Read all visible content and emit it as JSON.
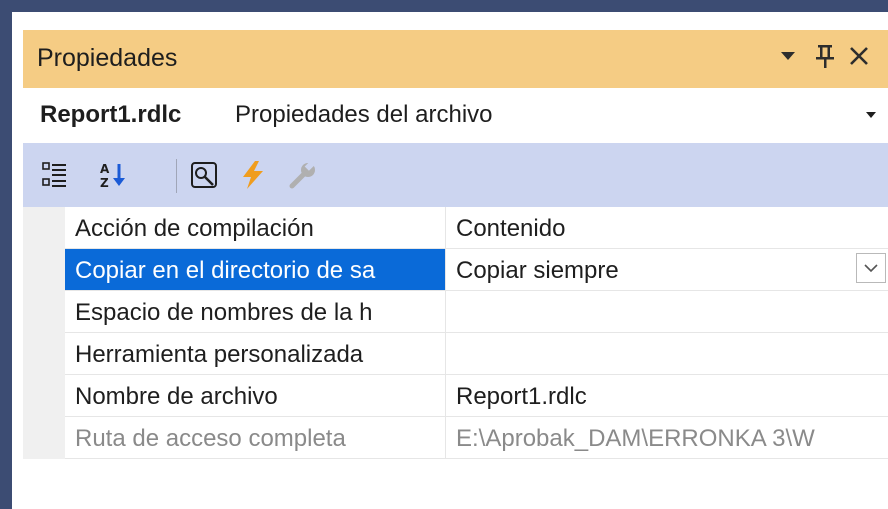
{
  "window": {
    "title": "Propiedades"
  },
  "object_selector": {
    "name": "Report1.rdlc",
    "type": "Propiedades del archivo"
  },
  "toolbar": {
    "buttons": [
      {
        "icon": "categorized-icon"
      },
      {
        "icon": "alphabetical-sort-icon"
      },
      {
        "icon": "property-pages-icon"
      },
      {
        "icon": "events-lightning-icon"
      },
      {
        "icon": "wrench-icon"
      }
    ]
  },
  "properties": [
    {
      "name": "Acción de compilación",
      "value": "Contenido"
    },
    {
      "name": "Copiar en el directorio de sa",
      "value": "Copiar siempre",
      "selected": true
    },
    {
      "name": "Espacio de nombres de la h",
      "value": ""
    },
    {
      "name": "Herramienta personalizada",
      "value": ""
    },
    {
      "name": "Nombre de archivo",
      "value": "Report1.rdlc"
    },
    {
      "name": "Ruta de acceso completa",
      "value": "E:\\Aprobak_DAM\\ERRONKA 3\\W",
      "readonly": true
    }
  ],
  "colors": {
    "titlebar": "#f5cc84",
    "toolbar": "#ccd5f0",
    "selection": "#0a6ad8",
    "frame": "#3c4c73"
  }
}
